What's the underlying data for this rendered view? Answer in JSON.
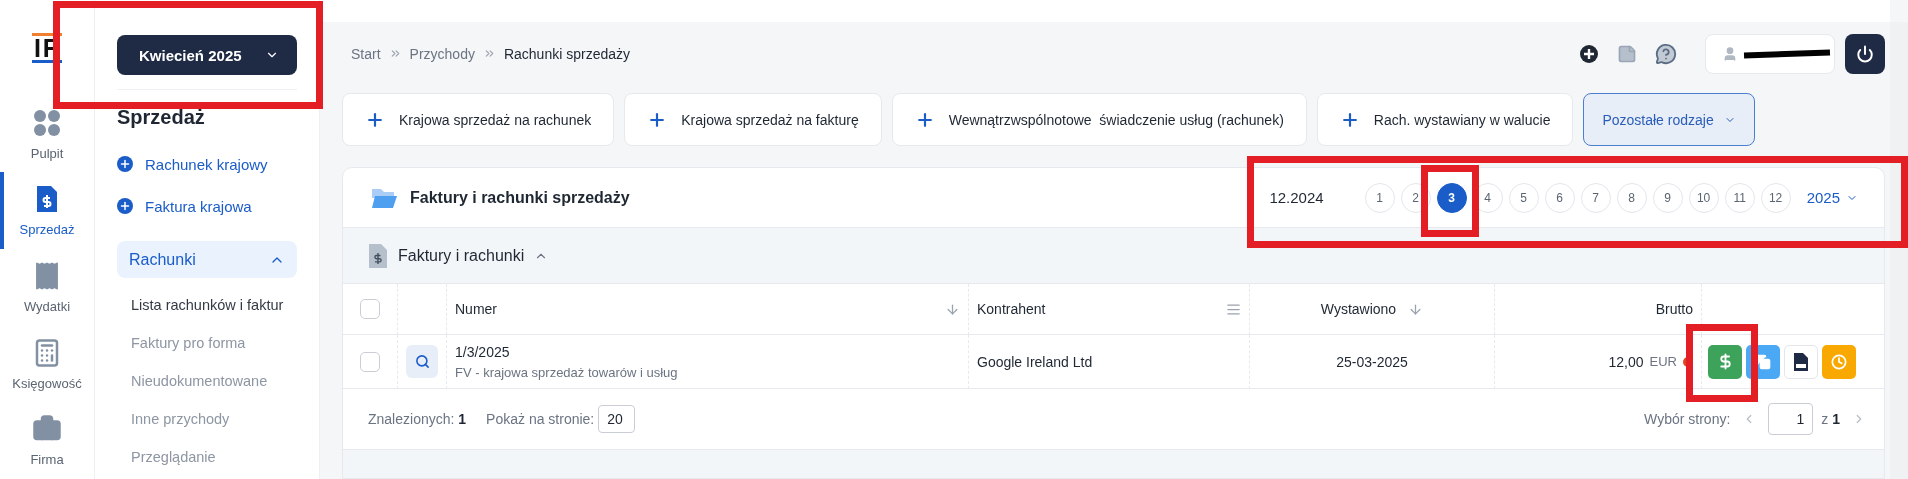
{
  "logo": "IF",
  "month_picker": {
    "label": "Kwiecień 2025"
  },
  "nav_rail": [
    {
      "label": "Pulpit",
      "selected": false
    },
    {
      "label": "Sprzedaż",
      "selected": true
    },
    {
      "label": "Wydatki",
      "selected": false
    },
    {
      "label": "Księgowość",
      "selected": false
    },
    {
      "label": "Firma",
      "selected": false
    }
  ],
  "sidebar": {
    "title": "Sprzedaż",
    "quick_add": [
      "Rachunek krajowy",
      "Faktura krajowa"
    ],
    "group": {
      "label": "Rachunki",
      "expanded": true,
      "items": [
        {
          "label": "Lista rachunków i faktur",
          "selected": true
        },
        {
          "label": "Faktury pro forma",
          "selected": false
        },
        {
          "label": "Nieudokumentowane",
          "selected": false
        },
        {
          "label": "Inne przychody",
          "selected": false
        },
        {
          "label": "Przeglądanie",
          "selected": false
        }
      ]
    }
  },
  "breadcrumb": [
    "Start",
    "Przychody",
    "Rachunki sprzedaży"
  ],
  "add_buttons": [
    "Krajowa sprzedaż na rachunek",
    "Krajowa sprzedaż na fakturę",
    "Wewnątrzwspólnotowe  świadczenie usług (rachunek)",
    "Rach. wystawiany w walucie"
  ],
  "more_types": {
    "label": "Pozostałe rodzaje"
  },
  "panel": {
    "title": "Faktury i rachunki sprzedaży",
    "period": {
      "previous": "12.2024",
      "months": [
        {
          "label": "1",
          "selected": false
        },
        {
          "label": "2",
          "selected": false
        },
        {
          "label": "3",
          "selected": true
        },
        {
          "label": "4",
          "selected": false
        },
        {
          "label": "5",
          "selected": false
        },
        {
          "label": "6",
          "selected": false
        },
        {
          "label": "7",
          "selected": false
        },
        {
          "label": "8",
          "selected": false
        },
        {
          "label": "9",
          "selected": false
        },
        {
          "label": "10",
          "selected": false
        },
        {
          "label": "11",
          "selected": false
        },
        {
          "label": "12",
          "selected": false
        }
      ],
      "year": "2025"
    }
  },
  "section": {
    "title": "Faktury i rachunki",
    "expanded": true
  },
  "table": {
    "all_checked": false,
    "columns": [
      {
        "label": "Numer",
        "kind": "sort"
      },
      {
        "label": "Kontrahent",
        "kind": "menu"
      },
      {
        "label": "Wystawiono",
        "kind": "sort"
      },
      {
        "label": "Brutto",
        "kind": "plain"
      }
    ],
    "rows": [
      {
        "checked": false,
        "number": "1/3/2025",
        "type": "FV - krajowa sprzedaż towarów i usług",
        "contractor": "Google Ireland Ltd",
        "issued": "25-03-2025",
        "amount": "12,00",
        "currency": "EUR"
      }
    ]
  },
  "footer": {
    "found": "Znalezionych: **1**",
    "per_page_label": "Pokaż na stronie:",
    "per_page": "20",
    "page_label": "Wybór strony:",
    "page": "1",
    "of": "z **1**"
  }
}
